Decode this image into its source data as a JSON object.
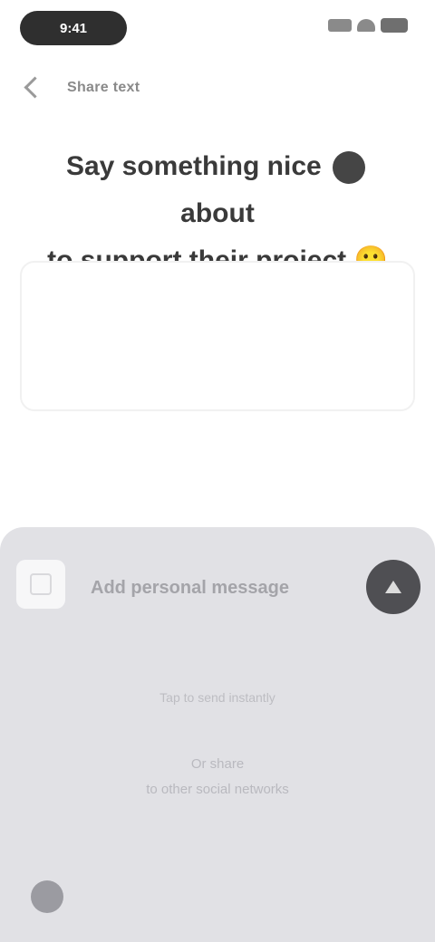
{
  "status_bar": {
    "time": "9:41"
  },
  "nav": {
    "title": "Share text",
    "subtitle": "",
    "action": ""
  },
  "headline": {
    "part1": "Say something nice",
    "part2": "about",
    "line2": "to support their project",
    "emoji": "🙂"
  },
  "card": {
    "text": ""
  },
  "sheet": {
    "input_label": "Add personal message",
    "hint": "Tap to send instantly",
    "options_line1": "Or share",
    "options_line2": "to other social networks"
  }
}
